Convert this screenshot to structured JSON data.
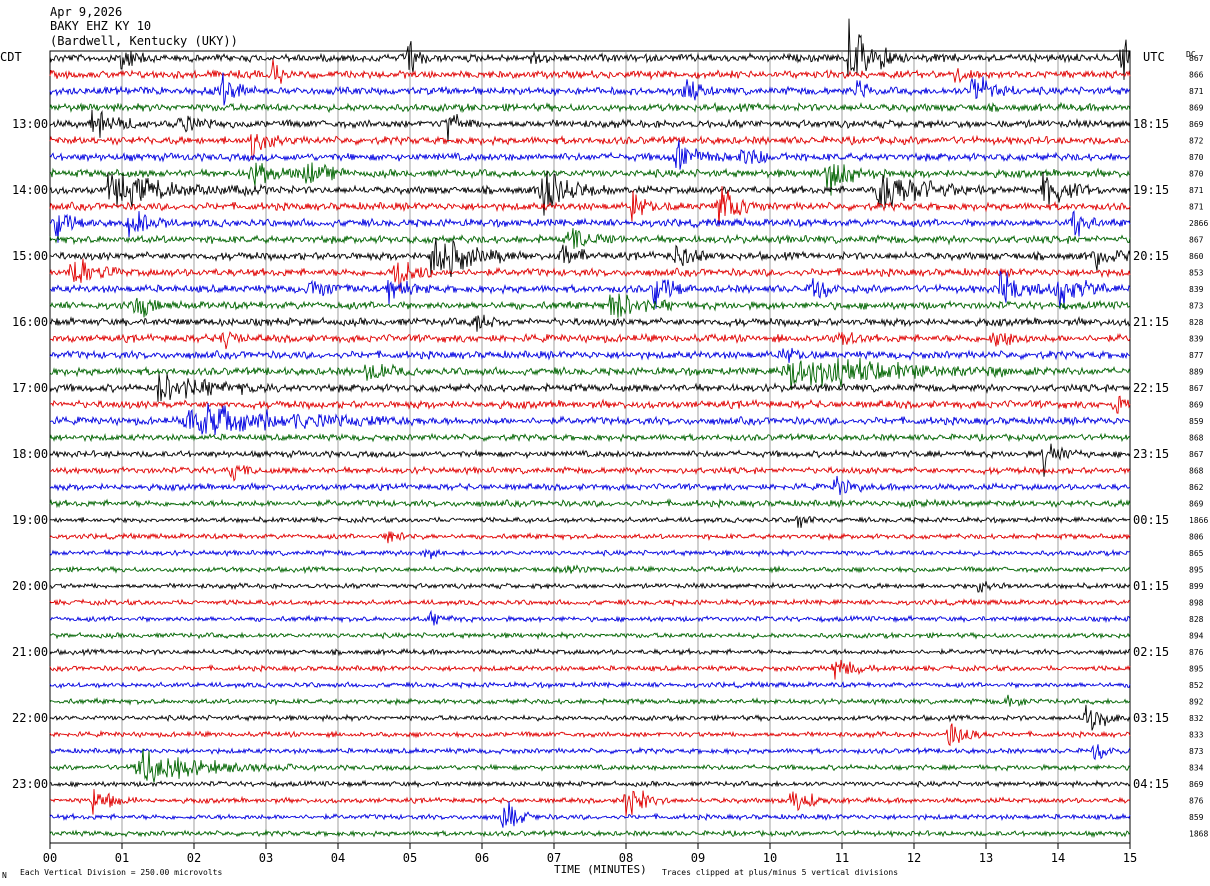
{
  "header": {
    "date": "Apr 9,2026",
    "station": "BAKY EHZ KY 10",
    "location": "(Bardwell, Kentucky (UKY))"
  },
  "left_tz": "CDT",
  "right_tz": "UTC",
  "dc_label": "DC",
  "footer": {
    "scale": "Each Vertical Division =  250.00 microvolts",
    "clip": "Traces clipped at plus/minus 5 vertical divisions",
    "corner": "N"
  },
  "chart_data": {
    "type": "line",
    "title": "",
    "xlabel": "TIME (MINUTES)",
    "ylabel": "",
    "x_ticks": [
      "00",
      "01",
      "02",
      "03",
      "04",
      "05",
      "06",
      "07",
      "08",
      "09",
      "10",
      "11",
      "12",
      "13",
      "14",
      "15"
    ],
    "xlim": [
      0,
      15
    ],
    "trace_minutes": 15,
    "trace_count": 48,
    "color_cycle": [
      "#000000",
      "#e00000",
      "#0000e0",
      "#006400"
    ],
    "left_labels": [
      {
        "row": 4,
        "text": "13:00"
      },
      {
        "row": 8,
        "text": "14:00"
      },
      {
        "row": 12,
        "text": "15:00"
      },
      {
        "row": 16,
        "text": "16:00"
      },
      {
        "row": 20,
        "text": "17:00"
      },
      {
        "row": 24,
        "text": "18:00"
      },
      {
        "row": 28,
        "text": "19:00"
      },
      {
        "row": 32,
        "text": "20:00"
      },
      {
        "row": 36,
        "text": "21:00"
      },
      {
        "row": 40,
        "text": "22:00"
      },
      {
        "row": 44,
        "text": "23:00"
      }
    ],
    "right_labels": [
      {
        "row": 4,
        "text": "18:15"
      },
      {
        "row": 8,
        "text": "19:15"
      },
      {
        "row": 12,
        "text": "20:15"
      },
      {
        "row": 16,
        "text": "21:15"
      },
      {
        "row": 20,
        "text": "22:15"
      },
      {
        "row": 24,
        "text": "23:15"
      },
      {
        "row": 28,
        "text": "00:15"
      },
      {
        "row": 32,
        "text": "01:15"
      },
      {
        "row": 36,
        "text": "02:15"
      },
      {
        "row": 40,
        "text": "03:15"
      },
      {
        "row": 44,
        "text": "04:15"
      }
    ],
    "dc_offsets": [
      "867",
      "866",
      "871",
      "869",
      "869",
      "872",
      "870",
      "870",
      "871",
      "871",
      "2866",
      "867",
      "860",
      "853",
      "839",
      "873",
      "828",
      "839",
      "877",
      "889",
      "867",
      "869",
      "859",
      "868",
      "867",
      "868",
      "862",
      "869",
      "1866",
      "806",
      "865",
      "895",
      "899",
      "898",
      "828",
      "894",
      "876",
      "895",
      "852",
      "892",
      "832",
      "833",
      "873",
      "834",
      "869",
      "876",
      "859",
      "1868"
    ],
    "noise_level": [
      3,
      3,
      3,
      3,
      3,
      3,
      3,
      3,
      3,
      3,
      3,
      3,
      3,
      3,
      3,
      3,
      3,
      3,
      3,
      3,
      3,
      3,
      3,
      2.5,
      2.5,
      2.5,
      2.5,
      2.5,
      2,
      2,
      2,
      2,
      2,
      2,
      2,
      2,
      2,
      2,
      2,
      2,
      2,
      2,
      2,
      2,
      2,
      2,
      2,
      2
    ],
    "events": [
      {
        "row": 0,
        "minute": 1.0,
        "amp": 16,
        "dur": 0.5
      },
      {
        "row": 0,
        "minute": 5.0,
        "amp": 24,
        "dur": 0.3
      },
      {
        "row": 0,
        "minute": 6.7,
        "amp": 10,
        "dur": 0.3
      },
      {
        "row": 0,
        "minute": 11.1,
        "amp": 38,
        "dur": 0.8
      },
      {
        "row": 0,
        "minute": 14.9,
        "amp": 30,
        "dur": 0.3
      },
      {
        "row": 1,
        "minute": 3.1,
        "amp": 14,
        "dur": 0.5
      },
      {
        "row": 1,
        "minute": 12.6,
        "amp": 10,
        "dur": 0.3
      },
      {
        "row": 2,
        "minute": 2.4,
        "amp": 16,
        "dur": 0.5
      },
      {
        "row": 2,
        "minute": 8.8,
        "amp": 14,
        "dur": 0.5
      },
      {
        "row": 2,
        "minute": 11.2,
        "amp": 12,
        "dur": 0.4
      },
      {
        "row": 2,
        "minute": 12.8,
        "amp": 22,
        "dur": 0.7
      },
      {
        "row": 4,
        "minute": 0.6,
        "amp": 14,
        "dur": 0.8
      },
      {
        "row": 4,
        "minute": 1.8,
        "amp": 10,
        "dur": 0.6
      },
      {
        "row": 4,
        "minute": 5.5,
        "amp": 20,
        "dur": 0.4
      },
      {
        "row": 5,
        "minute": 2.8,
        "amp": 16,
        "dur": 0.6
      },
      {
        "row": 6,
        "minute": 8.7,
        "amp": 16,
        "dur": 0.7
      },
      {
        "row": 6,
        "minute": 9.6,
        "amp": 10,
        "dur": 0.8
      },
      {
        "row": 7,
        "minute": 2.8,
        "amp": 14,
        "dur": 0.8
      },
      {
        "row": 7,
        "minute": 3.5,
        "amp": 14,
        "dur": 0.8
      },
      {
        "row": 7,
        "minute": 10.8,
        "amp": 20,
        "dur": 0.8
      },
      {
        "row": 8,
        "minute": 0.8,
        "amp": 16,
        "dur": 2.5
      },
      {
        "row": 8,
        "minute": 6.8,
        "amp": 24,
        "dur": 1.0
      },
      {
        "row": 8,
        "minute": 11.5,
        "amp": 24,
        "dur": 1.6
      },
      {
        "row": 8,
        "minute": 13.8,
        "amp": 20,
        "dur": 0.8
      },
      {
        "row": 9,
        "minute": 8.1,
        "amp": 16,
        "dur": 0.5
      },
      {
        "row": 9,
        "minute": 9.3,
        "amp": 22,
        "dur": 0.7
      },
      {
        "row": 10,
        "minute": 0.1,
        "amp": 16,
        "dur": 0.5
      },
      {
        "row": 10,
        "minute": 1.1,
        "amp": 16,
        "dur": 0.6
      },
      {
        "row": 10,
        "minute": 14.2,
        "amp": 16,
        "dur": 0.5
      },
      {
        "row": 11,
        "minute": 7.2,
        "amp": 12,
        "dur": 0.8
      },
      {
        "row": 12,
        "minute": 5.3,
        "amp": 30,
        "dur": 1.2
      },
      {
        "row": 12,
        "minute": 7.1,
        "amp": 16,
        "dur": 0.5
      },
      {
        "row": 12,
        "minute": 8.7,
        "amp": 12,
        "dur": 0.6
      },
      {
        "row": 12,
        "minute": 14.5,
        "amp": 14,
        "dur": 0.6
      },
      {
        "row": 13,
        "minute": 0.3,
        "amp": 22,
        "dur": 0.7
      },
      {
        "row": 13,
        "minute": 4.8,
        "amp": 22,
        "dur": 0.7
      },
      {
        "row": 14,
        "minute": 3.6,
        "amp": 12,
        "dur": 0.8
      },
      {
        "row": 14,
        "minute": 4.7,
        "amp": 14,
        "dur": 0.6
      },
      {
        "row": 14,
        "minute": 8.4,
        "amp": 16,
        "dur": 0.7
      },
      {
        "row": 14,
        "minute": 10.6,
        "amp": 12,
        "dur": 0.5
      },
      {
        "row": 14,
        "minute": 13.2,
        "amp": 20,
        "dur": 0.8
      },
      {
        "row": 14,
        "minute": 14.0,
        "amp": 22,
        "dur": 0.7
      },
      {
        "row": 15,
        "minute": 1.2,
        "amp": 12,
        "dur": 0.5
      },
      {
        "row": 15,
        "minute": 7.8,
        "amp": 16,
        "dur": 0.9
      },
      {
        "row": 16,
        "minute": 5.9,
        "amp": 10,
        "dur": 0.5
      },
      {
        "row": 17,
        "minute": 2.4,
        "amp": 10,
        "dur": 0.4
      },
      {
        "row": 17,
        "minute": 10.9,
        "amp": 12,
        "dur": 0.5
      },
      {
        "row": 17,
        "minute": 13.1,
        "amp": 14,
        "dur": 0.5
      },
      {
        "row": 18,
        "minute": 10.2,
        "amp": 10,
        "dur": 0.5
      },
      {
        "row": 19,
        "minute": 4.4,
        "amp": 12,
        "dur": 0.6
      },
      {
        "row": 19,
        "minute": 10.2,
        "amp": 18,
        "dur": 3.8
      },
      {
        "row": 20,
        "minute": 1.5,
        "amp": 14,
        "dur": 1.8
      },
      {
        "row": 21,
        "minute": 14.8,
        "amp": 10,
        "dur": 0.5
      },
      {
        "row": 22,
        "minute": 1.9,
        "amp": 18,
        "dur": 3.5
      },
      {
        "row": 24,
        "minute": 13.8,
        "amp": 20,
        "dur": 0.6
      },
      {
        "row": 25,
        "minute": 2.5,
        "amp": 10,
        "dur": 0.5
      },
      {
        "row": 26,
        "minute": 10.9,
        "amp": 14,
        "dur": 0.5
      },
      {
        "row": 27,
        "minute": 11.9,
        "amp": 8,
        "dur": 0.3
      },
      {
        "row": 28,
        "minute": 10.4,
        "amp": 8,
        "dur": 0.4
      },
      {
        "row": 29,
        "minute": 4.7,
        "amp": 8,
        "dur": 0.5
      },
      {
        "row": 30,
        "minute": 5.2,
        "amp": 7,
        "dur": 0.4
      },
      {
        "row": 31,
        "minute": 7.2,
        "amp": 7,
        "dur": 0.4
      },
      {
        "row": 32,
        "minute": 12.9,
        "amp": 7,
        "dur": 0.4
      },
      {
        "row": 34,
        "minute": 5.3,
        "amp": 6,
        "dur": 0.4
      },
      {
        "row": 37,
        "minute": 10.9,
        "amp": 14,
        "dur": 0.6
      },
      {
        "row": 39,
        "minute": 13.3,
        "amp": 6,
        "dur": 0.5
      },
      {
        "row": 40,
        "minute": 14.4,
        "amp": 18,
        "dur": 0.6
      },
      {
        "row": 41,
        "minute": 12.5,
        "amp": 14,
        "dur": 0.6
      },
      {
        "row": 42,
        "minute": 14.5,
        "amp": 8,
        "dur": 0.6
      },
      {
        "row": 43,
        "minute": 1.2,
        "amp": 16,
        "dur": 2.5
      },
      {
        "row": 45,
        "minute": 0.6,
        "amp": 18,
        "dur": 0.6
      },
      {
        "row": 45,
        "minute": 8.0,
        "amp": 22,
        "dur": 0.6
      },
      {
        "row": 45,
        "minute": 10.3,
        "amp": 16,
        "dur": 0.6
      },
      {
        "row": 46,
        "minute": 6.3,
        "amp": 18,
        "dur": 0.5
      }
    ]
  }
}
